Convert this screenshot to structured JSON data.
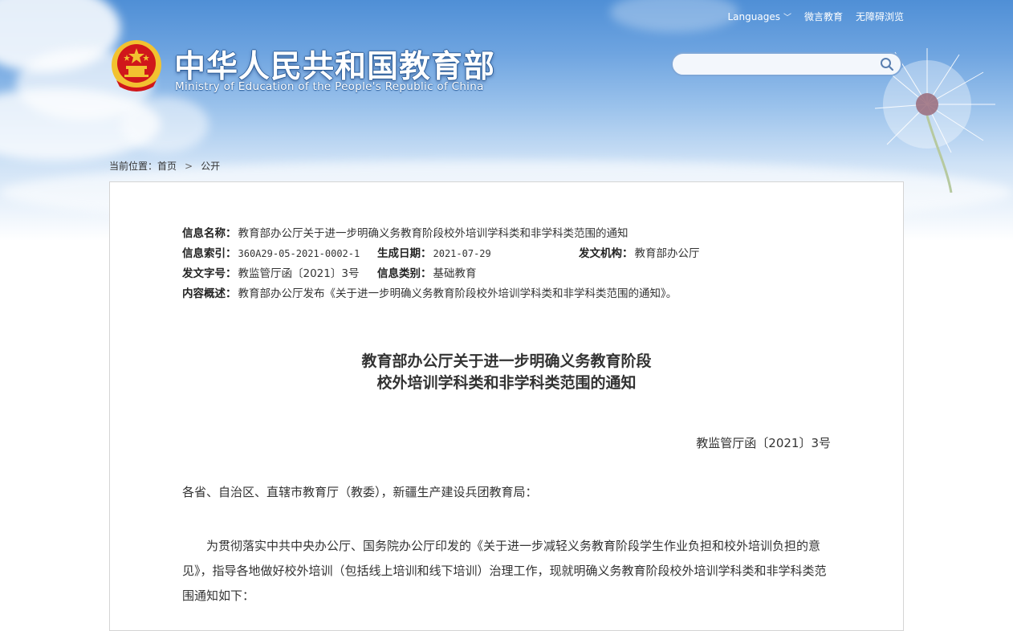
{
  "header": {
    "title_cn": "中华人民共和国教育部",
    "title_en": "Ministry of Education of the People's Republic of China",
    "links": [
      {
        "label": "Languages"
      },
      {
        "label": "微言教育"
      },
      {
        "label": "无障碍浏览"
      }
    ],
    "search": {
      "placeholder": "",
      "value": ""
    }
  },
  "breadcrumb": {
    "prefix": "当前位置：",
    "home": "首页",
    "separator": ">",
    "current": "公开"
  },
  "meta": {
    "name_label": "信息名称：",
    "name_value": "教育部办公厅关于进一步明确义务教育阶段校外培训学科类和非学科类范围的通知",
    "index_label": "信息索引：",
    "index_value": "360A29-05-2021-0002-1",
    "date_label": "生成日期：",
    "date_value": "2021-07-29",
    "org_label": "发文机构：",
    "org_value": "教育部办公厅",
    "docno_label": "发文字号：",
    "docno_value": "教监管厅函〔2021〕3号",
    "category_label": "信息类别：",
    "category_value": "基础教育",
    "summary_label": "内容概述：",
    "summary_value": "教育部办公厅发布《关于进一步明确义务教育阶段校外培训学科类和非学科类范围的通知》。"
  },
  "document": {
    "title_line1": "教育部办公厅关于进一步明确义务教育阶段",
    "title_line2": "校外培训学科类和非学科类范围的通知",
    "doc_number": "教监管厅函〔2021〕3号",
    "salutation": "各省、自治区、直辖市教育厅（教委），新疆生产建设兵团教育局：",
    "paragraph1": "为贯彻落实中共中央办公厅、国务院办公厅印发的《关于进一步减轻义务教育阶段学生作业负担和校外培训负担的意见》，指导各地做好校外培训（包括线上培训和线下培训）治理工作，现就明确义务教育阶段校外培训学科类和非学科类范围通知如下："
  },
  "colors": {
    "sky_top": "#4f8fd6",
    "text": "#333333",
    "border": "#d4d4d4",
    "emblem_red": "#d0171b",
    "emblem_gold": "#f2c230"
  }
}
